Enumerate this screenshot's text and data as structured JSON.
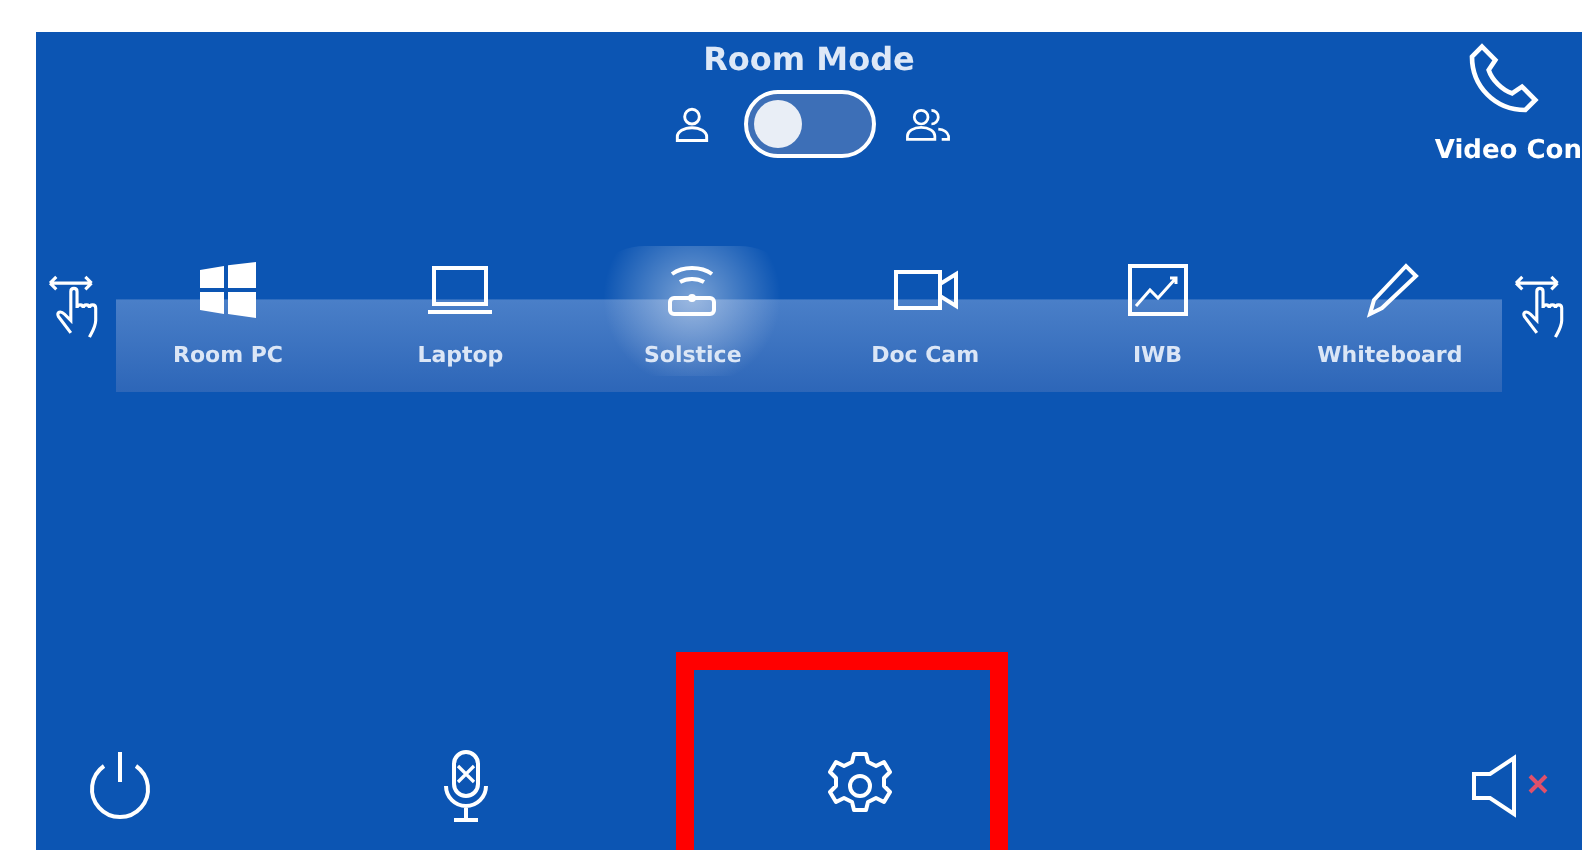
{
  "room_mode": {
    "title": "Room Mode",
    "on": false
  },
  "call_button": {
    "label": "Video Con"
  },
  "sources": [
    {
      "kind": "windows",
      "label": "Room PC",
      "selected": false
    },
    {
      "kind": "laptop",
      "label": "Laptop",
      "selected": false
    },
    {
      "kind": "wireless",
      "label": "Solstice",
      "selected": true
    },
    {
      "kind": "camera",
      "label": "Doc Cam",
      "selected": false
    },
    {
      "kind": "chart",
      "label": "IWB",
      "selected": false
    },
    {
      "kind": "pencil",
      "label": "Whiteboard",
      "selected": false
    }
  ],
  "bottom_buttons": [
    {
      "kind": "power"
    },
    {
      "kind": "mic"
    },
    {
      "kind": "settings",
      "highlighted": true
    },
    {
      "kind": "speaker"
    }
  ]
}
